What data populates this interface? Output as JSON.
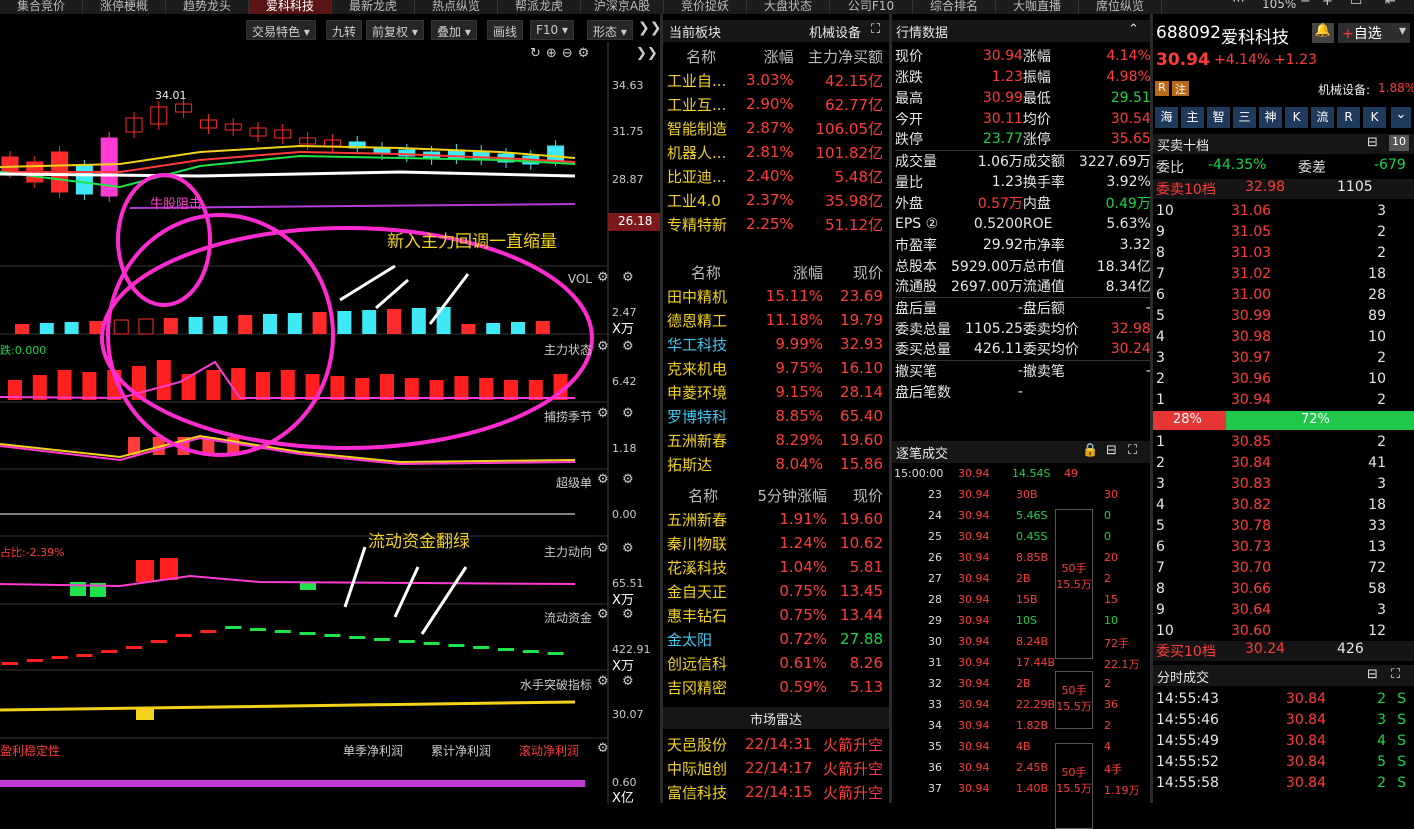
{
  "tabs": [
    "集合竞价",
    "涨停梗概",
    "趋势龙头",
    "爱科科技",
    "最新龙虎",
    "热点纵览",
    "帮派龙虎",
    "沪深京A股",
    "竞价捉妖",
    "大盘状态",
    "公司F10",
    "综合排名",
    "大咖直播",
    "席位纵览"
  ],
  "zoom": "105%",
  "toolbar": [
    "交易特色",
    "九转",
    "前复权",
    "叠加",
    "画线",
    "F10",
    "形态"
  ],
  "chart": {
    "price_ticks": [
      "34.63",
      "31.75",
      "28.87",
      "26.18"
    ],
    "high_label": "34.01",
    "annotation_main": "新入主力回调一直缩量",
    "annotation_resist": "牛股阻击",
    "annotation_flow": "流动资金翻绿",
    "panels": [
      {
        "name": "VOL",
        "val": "2.47",
        "unit": "X万"
      },
      {
        "name": "主力状态",
        "val": "6.42",
        "unit": "",
        "left": "跌:0.000"
      },
      {
        "name": "捕捞季节",
        "val": "1.18",
        "unit": ""
      },
      {
        "name": "超级单",
        "val": "0.00",
        "unit": ""
      },
      {
        "name": "主力动向",
        "val": "65.51",
        "unit": "X万",
        "left": "占比:-2.39%"
      },
      {
        "name": "流动资金",
        "val": "422.91",
        "unit": "X万"
      },
      {
        "name": "水手突破指标",
        "val": "30.07",
        "unit": ""
      }
    ],
    "bottom_tabs": [
      "单季净利润",
      "累计净利润",
      "滚动净利润"
    ],
    "bottom_left": "盈利稳定性",
    "bottom_val": "0.60",
    "bottom_unit": "X亿"
  },
  "sector": {
    "title": "当前板块",
    "name": "机械设备",
    "head1": [
      "名称",
      "涨幅",
      "主力净买额"
    ],
    "rows1": [
      [
        "工业自...",
        "3.03%",
        "42.15亿"
      ],
      [
        "工业互...",
        "2.90%",
        "62.77亿"
      ],
      [
        "智能制造",
        "2.87%",
        "106.05亿"
      ],
      [
        "机器人...",
        "2.81%",
        "101.82亿"
      ],
      [
        "比亚迪...",
        "2.40%",
        "5.48亿"
      ],
      [
        "工业4.0",
        "2.37%",
        "35.98亿"
      ],
      [
        "专精特新",
        "2.25%",
        "51.12亿"
      ]
    ],
    "head2": [
      "名称",
      "涨幅",
      "现价"
    ],
    "rows2": [
      [
        "田中精机",
        "15.11%",
        "23.69"
      ],
      [
        "德恩精工",
        "11.18%",
        "19.79"
      ],
      [
        "华工科技",
        "9.99%",
        "32.93"
      ],
      [
        "克来机电",
        "9.75%",
        "16.10"
      ],
      [
        "申菱环境",
        "9.15%",
        "28.14"
      ],
      [
        "罗博特科",
        "8.85%",
        "65.40"
      ],
      [
        "五洲新春",
        "8.29%",
        "19.60"
      ],
      [
        "拓斯达",
        "8.04%",
        "15.86"
      ]
    ],
    "head3": [
      "名称",
      "5分钟涨幅",
      "现价"
    ],
    "rows3": [
      [
        "五洲新春",
        "1.91%",
        "19.60"
      ],
      [
        "秦川物联",
        "1.24%",
        "10.62"
      ],
      [
        "花溪科技",
        "1.04%",
        "5.81"
      ],
      [
        "金自天正",
        "0.75%",
        "13.45"
      ],
      [
        "惠丰钻石",
        "0.75%",
        "13.44"
      ],
      [
        "金太阳",
        "0.72%",
        "27.88"
      ],
      [
        "创远信科",
        "0.61%",
        "8.26"
      ],
      [
        "吉冈精密",
        "0.59%",
        "5.13"
      ]
    ],
    "radar_title": "市场雷达",
    "radar": [
      [
        "天邑股份",
        "22/14:31",
        "火箭升空"
      ],
      [
        "中际旭创",
        "22/14:17",
        "火箭升空"
      ],
      [
        "富信科技",
        "22/14:15",
        "火箭升空"
      ]
    ]
  },
  "quote": {
    "title": "行情数据",
    "rows": [
      [
        "现价",
        "30.94",
        "涨幅",
        "4.14%"
      ],
      [
        "涨跌",
        "1.23",
        "振幅",
        "4.98%"
      ],
      [
        "最高",
        "30.99",
        "最低",
        "29.51"
      ],
      [
        "今开",
        "30.11",
        "均价",
        "30.54"
      ],
      [
        "跌停",
        "23.77",
        "涨停",
        "35.65"
      ],
      [
        "成交量",
        "1.06万",
        "成交额",
        "3227.69万"
      ],
      [
        "量比",
        "1.23",
        "换手率",
        "3.92%"
      ],
      [
        "外盘",
        "0.57万",
        "内盘",
        "0.49万"
      ],
      [
        "EPS ②",
        "0.5200",
        "ROE",
        "5.63%"
      ],
      [
        "市盈率",
        "29.92",
        "市净率",
        "3.32"
      ],
      [
        "总股本",
        "5929.00万",
        "总市值",
        "18.34亿"
      ],
      [
        "流通股",
        "2697.00万",
        "流通值",
        "8.34亿"
      ],
      [
        "盘后量",
        "-",
        "盘后额",
        "-"
      ],
      [
        "委卖总量",
        "1105.25",
        "委卖均价",
        "32.98"
      ],
      [
        "委买总量",
        "426.11",
        "委买均价",
        "30.24"
      ],
      [
        "撤买笔",
        "-",
        "撤卖笔",
        "-"
      ],
      [
        "盘后笔数",
        "-",
        "",
        ""
      ]
    ]
  },
  "ticks": {
    "title": "逐笔成交",
    "first": [
      "15:00:00",
      "30.94",
      "14.54S",
      "49"
    ],
    "rows": [
      [
        "23",
        "30.94",
        "30B",
        "30"
      ],
      [
        "24",
        "30.94",
        "5.46S",
        "0"
      ],
      [
        "25",
        "30.94",
        "0.45S",
        "0"
      ],
      [
        "26",
        "30.94",
        "8.85B",
        "20"
      ],
      [
        "27",
        "30.94",
        "2B",
        "2"
      ],
      [
        "28",
        "30.94",
        "15B",
        "15"
      ],
      [
        "29",
        "30.94",
        "10S",
        "10"
      ],
      [
        "30",
        "30.94",
        "8.24B",
        "72手"
      ],
      [
        "31",
        "30.94",
        "17.44B",
        "22.1万"
      ],
      [
        "32",
        "30.94",
        "2B",
        "2"
      ],
      [
        "33",
        "30.94",
        "22.29B",
        "36"
      ],
      [
        "34",
        "30.94",
        "1.82B",
        "2"
      ],
      [
        "35",
        "30.94",
        "4B",
        "4"
      ],
      [
        "36",
        "30.94",
        "2.45B",
        "4手"
      ],
      [
        "37",
        "30.94",
        "1.40B",
        "1.19万"
      ]
    ],
    "blocks": [
      [
        "50手",
        "15.5万"
      ],
      [
        "50手",
        "15.5万"
      ],
      [
        "50手",
        "15.5万"
      ]
    ]
  },
  "stock": {
    "code": "688092",
    "name": "爱科科技",
    "price": "30.94",
    "chg": "+4.14%",
    "chgv": "+1.23",
    "fav": "自选",
    "sector": "机械设备:",
    "sector_pct": "1.88%",
    "badges": [
      "R",
      "注"
    ],
    "btns": [
      "海",
      "主",
      "智",
      "三",
      "神",
      "K",
      "流",
      "R",
      "K"
    ]
  },
  "book": {
    "title": "买卖十档",
    "wb_l": "委比",
    "wb": "-44.35%",
    "wc_l": "委差",
    "wc": "-679",
    "ask10_l": "委卖10档",
    "ask10": "32.98",
    "ask10v": "1105",
    "asks": [
      [
        "10",
        "31.06",
        "3"
      ],
      [
        "9",
        "31.05",
        "2"
      ],
      [
        "8",
        "31.03",
        "2"
      ],
      [
        "7",
        "31.02",
        "18"
      ],
      [
        "6",
        "31.00",
        "28"
      ],
      [
        "5",
        "30.99",
        "89"
      ],
      [
        "4",
        "30.98",
        "10"
      ],
      [
        "3",
        "30.97",
        "2"
      ],
      [
        "2",
        "30.96",
        "10"
      ],
      [
        "1",
        "30.94",
        "2"
      ]
    ],
    "bar_l": "28%",
    "bar_r": "72%",
    "bar_frac": 0.28,
    "bids": [
      [
        "1",
        "30.85",
        "2"
      ],
      [
        "2",
        "30.84",
        "41"
      ],
      [
        "3",
        "30.83",
        "3"
      ],
      [
        "4",
        "30.82",
        "18"
      ],
      [
        "5",
        "30.78",
        "33"
      ],
      [
        "6",
        "30.73",
        "13"
      ],
      [
        "7",
        "30.70",
        "72"
      ],
      [
        "8",
        "30.66",
        "58"
      ],
      [
        "9",
        "30.64",
        "3"
      ],
      [
        "10",
        "30.60",
        "12"
      ]
    ],
    "bid10_l": "委买10档",
    "bid10": "30.24",
    "bid10v": "426"
  },
  "trades": {
    "title": "分时成交",
    "rows": [
      [
        "14:55:43",
        "30.84",
        "2",
        "S"
      ],
      [
        "14:55:46",
        "30.84",
        "3",
        "S"
      ],
      [
        "14:55:49",
        "30.84",
        "4",
        "S"
      ],
      [
        "14:55:52",
        "30.84",
        "5",
        "S"
      ],
      [
        "14:55:58",
        "30.84",
        "2",
        "S"
      ]
    ]
  }
}
